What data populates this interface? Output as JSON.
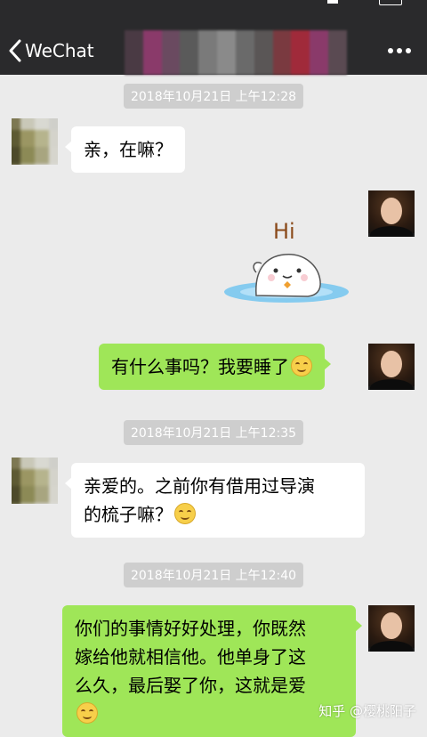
{
  "navbar": {
    "back_label": "WeChat"
  },
  "messages": [
    {
      "type": "timestamp",
      "text": "2018年10月21日 上午12:28"
    },
    {
      "type": "incoming",
      "text": "亲，在嘛？"
    },
    {
      "type": "sticker",
      "sticker_text": "Hi"
    },
    {
      "type": "outgoing",
      "text": "有什么事吗？我要睡了",
      "emoji": "blush-emoji"
    },
    {
      "type": "timestamp",
      "text": "2018年10月21日 上午12:35"
    },
    {
      "type": "incoming",
      "lines": [
        "亲爱的。之前你有借用过导演",
        "的梳子嘛？"
      ],
      "emoji": "smile-emoji"
    },
    {
      "type": "timestamp",
      "text": "2018年10月21日 上午12:40"
    },
    {
      "type": "outgoing",
      "lines": [
        "你们的事情好好处理，你既然",
        "嫁给他就相信他。他单身了这",
        "么久，最后娶了你，这就是爱"
      ],
      "emoji": "smile-emoji"
    }
  ],
  "watermark": "知乎 @樱桃阳子",
  "colors": {
    "navbar": "#2a2a2c",
    "chat_background": "#ebebeb",
    "outgoing_bubble": "#9fe658",
    "incoming_bubble": "#ffffff",
    "timestamp_pill": "#cecece"
  }
}
